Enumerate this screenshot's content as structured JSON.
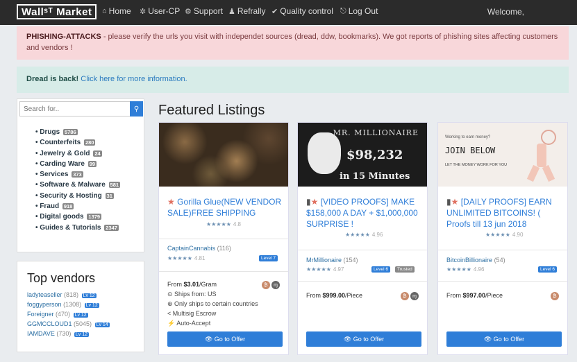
{
  "nav": {
    "logo": "Wallˢᵀ Market",
    "items": [
      {
        "label": "Home",
        "icon": "home-icon"
      },
      {
        "label": "User-CP",
        "icon": "tools-icon"
      },
      {
        "label": "Support",
        "icon": "support-icon"
      },
      {
        "label": "Refrally",
        "icon": "user-icon"
      },
      {
        "label": "Quality control",
        "icon": "check-icon"
      },
      {
        "label": "Log Out",
        "icon": "logout-icon"
      }
    ],
    "welcome": "Welcome,"
  },
  "alerts": {
    "phishing_title": "PHISHING-ATTACKS",
    "phishing_text": " - please verify the urls you visit with independet sources (dread, ddw, bookmarks). We got reports of phishing sites affecting customers and vendors !",
    "dread_title": "Dread is back!",
    "dread_link": "Click here for more information."
  },
  "search": {
    "placeholder": "Search for.."
  },
  "categories": [
    {
      "name": "Drugs",
      "count": "5786"
    },
    {
      "name": "Counterfeits",
      "count": "280"
    },
    {
      "name": "Jewelry & Gold",
      "count": "24"
    },
    {
      "name": "Carding Ware",
      "count": "99"
    },
    {
      "name": "Services",
      "count": "373"
    },
    {
      "name": "Software & Malware",
      "count": "581"
    },
    {
      "name": "Security & Hosting",
      "count": "31"
    },
    {
      "name": "Fraud",
      "count": "918"
    },
    {
      "name": "Digital goods",
      "count": "1379"
    },
    {
      "name": "Guides & Tutorials",
      "count": "2347"
    }
  ],
  "vendors": {
    "title": "Top vendors",
    "list": [
      {
        "name": "ladyteaseller",
        "count": "(818)",
        "level": "Lv 12"
      },
      {
        "name": "foggyperson",
        "count": "(1308)",
        "level": "Lv 12"
      },
      {
        "name": "Foreigner",
        "count": "(470)",
        "level": "Lv 12"
      },
      {
        "name": "GGMCCLOUD1",
        "count": "(5045)",
        "level": "Lv 14"
      },
      {
        "name": "IAMDAVE",
        "count": "(730)",
        "level": "Lv 12"
      }
    ]
  },
  "featured_title": "Featured Listings",
  "listings": [
    {
      "title": "Gorilla Glue(NEW VENDOR SALE)FREE SHIPPING",
      "rating": "4.8",
      "seller": "CaptainCannabis",
      "seller_count": "(116)",
      "seller_rating": "4.81",
      "level": "Level 7",
      "trusted": "",
      "price_from": "From ",
      "price": "$3.01",
      "unit": "/Gram",
      "features": [
        "Ships from: US",
        "Only ships to certain countries",
        "Multisig Escrow",
        "Auto-Accept"
      ],
      "button": "Go to Offer"
    },
    {
      "title": "[VIDEO PROOFS] MAKE $158,000 A DAY + $1,000,000 SURPRISE !",
      "rating": "4.96",
      "seller": "MrMillionaire",
      "seller_count": "(154)",
      "seller_rating": "4.97",
      "level": "Level 6",
      "trusted": "Trusted",
      "price_from": "From ",
      "price": "$999.00",
      "unit": "/Piece",
      "features": [],
      "button": "Go to Offer",
      "image_text": {
        "top": "MR. MILLIONAIRE",
        "amount": "$98,232",
        "bottom": "in 15 Minutes"
      }
    },
    {
      "title": "[DAILY PROOFS] EARN UNLIMITED BITCOINS! ( Proofs till 13 jun 2018",
      "rating": "4.90",
      "seller": "BitcoinBillionaire",
      "seller_count": "(54)",
      "seller_rating": "4.96",
      "level": "Level 6",
      "trusted": "",
      "price_from": "From ",
      "price": "$997.00",
      "unit": "/Piece",
      "features": [],
      "button": "Go to Offer",
      "image_text": {
        "small": "Working to earn money?",
        "main": "JOIN BELOW",
        "sub": "LET THE MONEY WORK FOR YOU"
      }
    }
  ],
  "colors": {
    "navbar": "#2b2b2b",
    "accent": "#2f7ed8",
    "alert_pink": "#f8d7da",
    "alert_teal": "#d7ece8"
  }
}
